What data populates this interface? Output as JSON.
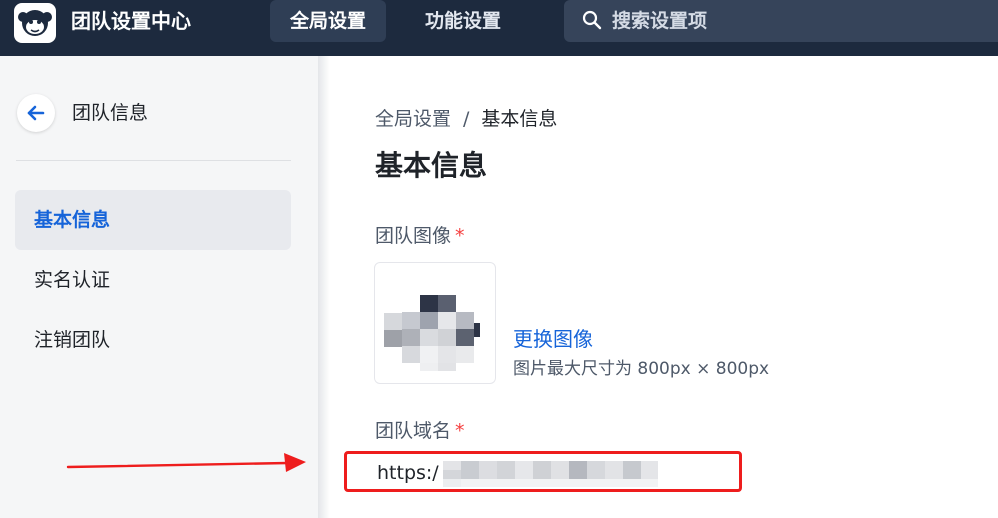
{
  "header": {
    "app_title": "团队设置中心",
    "tabs": [
      {
        "label": "全局设置",
        "active": true
      },
      {
        "label": "功能设置",
        "active": false
      }
    ],
    "search": {
      "placeholder": "搜索设置项",
      "value": ""
    }
  },
  "sidebar": {
    "title": "团队信息",
    "items": [
      {
        "label": "基本信息",
        "active": true
      },
      {
        "label": "实名认证",
        "active": false
      },
      {
        "label": "注销团队",
        "active": false
      }
    ]
  },
  "main": {
    "breadcrumb": {
      "parent": "全局设置",
      "separator": "/",
      "current": "基本信息"
    },
    "title": "基本信息",
    "avatar": {
      "label": "团队图像",
      "required_mark": "*",
      "change_link": "更换图像",
      "hint": "图片最大尺寸为 800px × 800px"
    },
    "domain": {
      "label": "团队域名",
      "required_mark": "*",
      "value_prefix": "https:/"
    }
  },
  "colors": {
    "header_bg": "#1d2a3e",
    "accent": "#1664d9",
    "required": "#f53f3f",
    "highlight_annotation": "#ee1d1d"
  }
}
